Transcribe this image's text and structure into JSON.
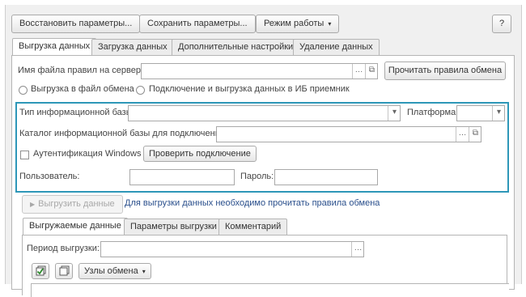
{
  "toolbar": {
    "restore_label": "Восстановить параметры...",
    "save_label": "Сохранить параметры...",
    "mode_label": "Режим работы",
    "help_label": "?"
  },
  "tabs": [
    {
      "label": "Выгрузка данных"
    },
    {
      "label": "Загрузка данных"
    },
    {
      "label": "Дополнительные настройки"
    },
    {
      "label": "Удаление данных"
    }
  ],
  "export": {
    "rules_file_label": "Имя файла правил на сервере:",
    "rules_file_value": "",
    "read_rules_label": "Прочитать правила обмена",
    "radio_file_label": "Выгрузка в файл обмена",
    "radio_connect_label": "Подключение и выгрузка данных в ИБ приемник",
    "ib_type_label": "Тип информационной базы:",
    "platform_label": "Платформа:",
    "catalog_label": "Каталог информационной базы для подключения:",
    "auth_label": "Аутентификация Windows",
    "check_conn_label": "Проверить подключение",
    "user_label": "Пользователь:",
    "password_label": "Пароль:",
    "run_export_label": "Выгрузить данные",
    "hint": "Для выгрузки данных необходимо прочитать правила обмена"
  },
  "subtabs": [
    {
      "label": "Выгружаемые данные"
    },
    {
      "label": "Параметры выгрузки"
    },
    {
      "label": "Комментарий"
    }
  ],
  "sub": {
    "period_label": "Период выгрузки:",
    "nodes_label": "Узлы обмена"
  },
  "icons": {
    "ellipsis": "…",
    "open": "⧉",
    "dropdown": "▾",
    "play": "▶"
  }
}
